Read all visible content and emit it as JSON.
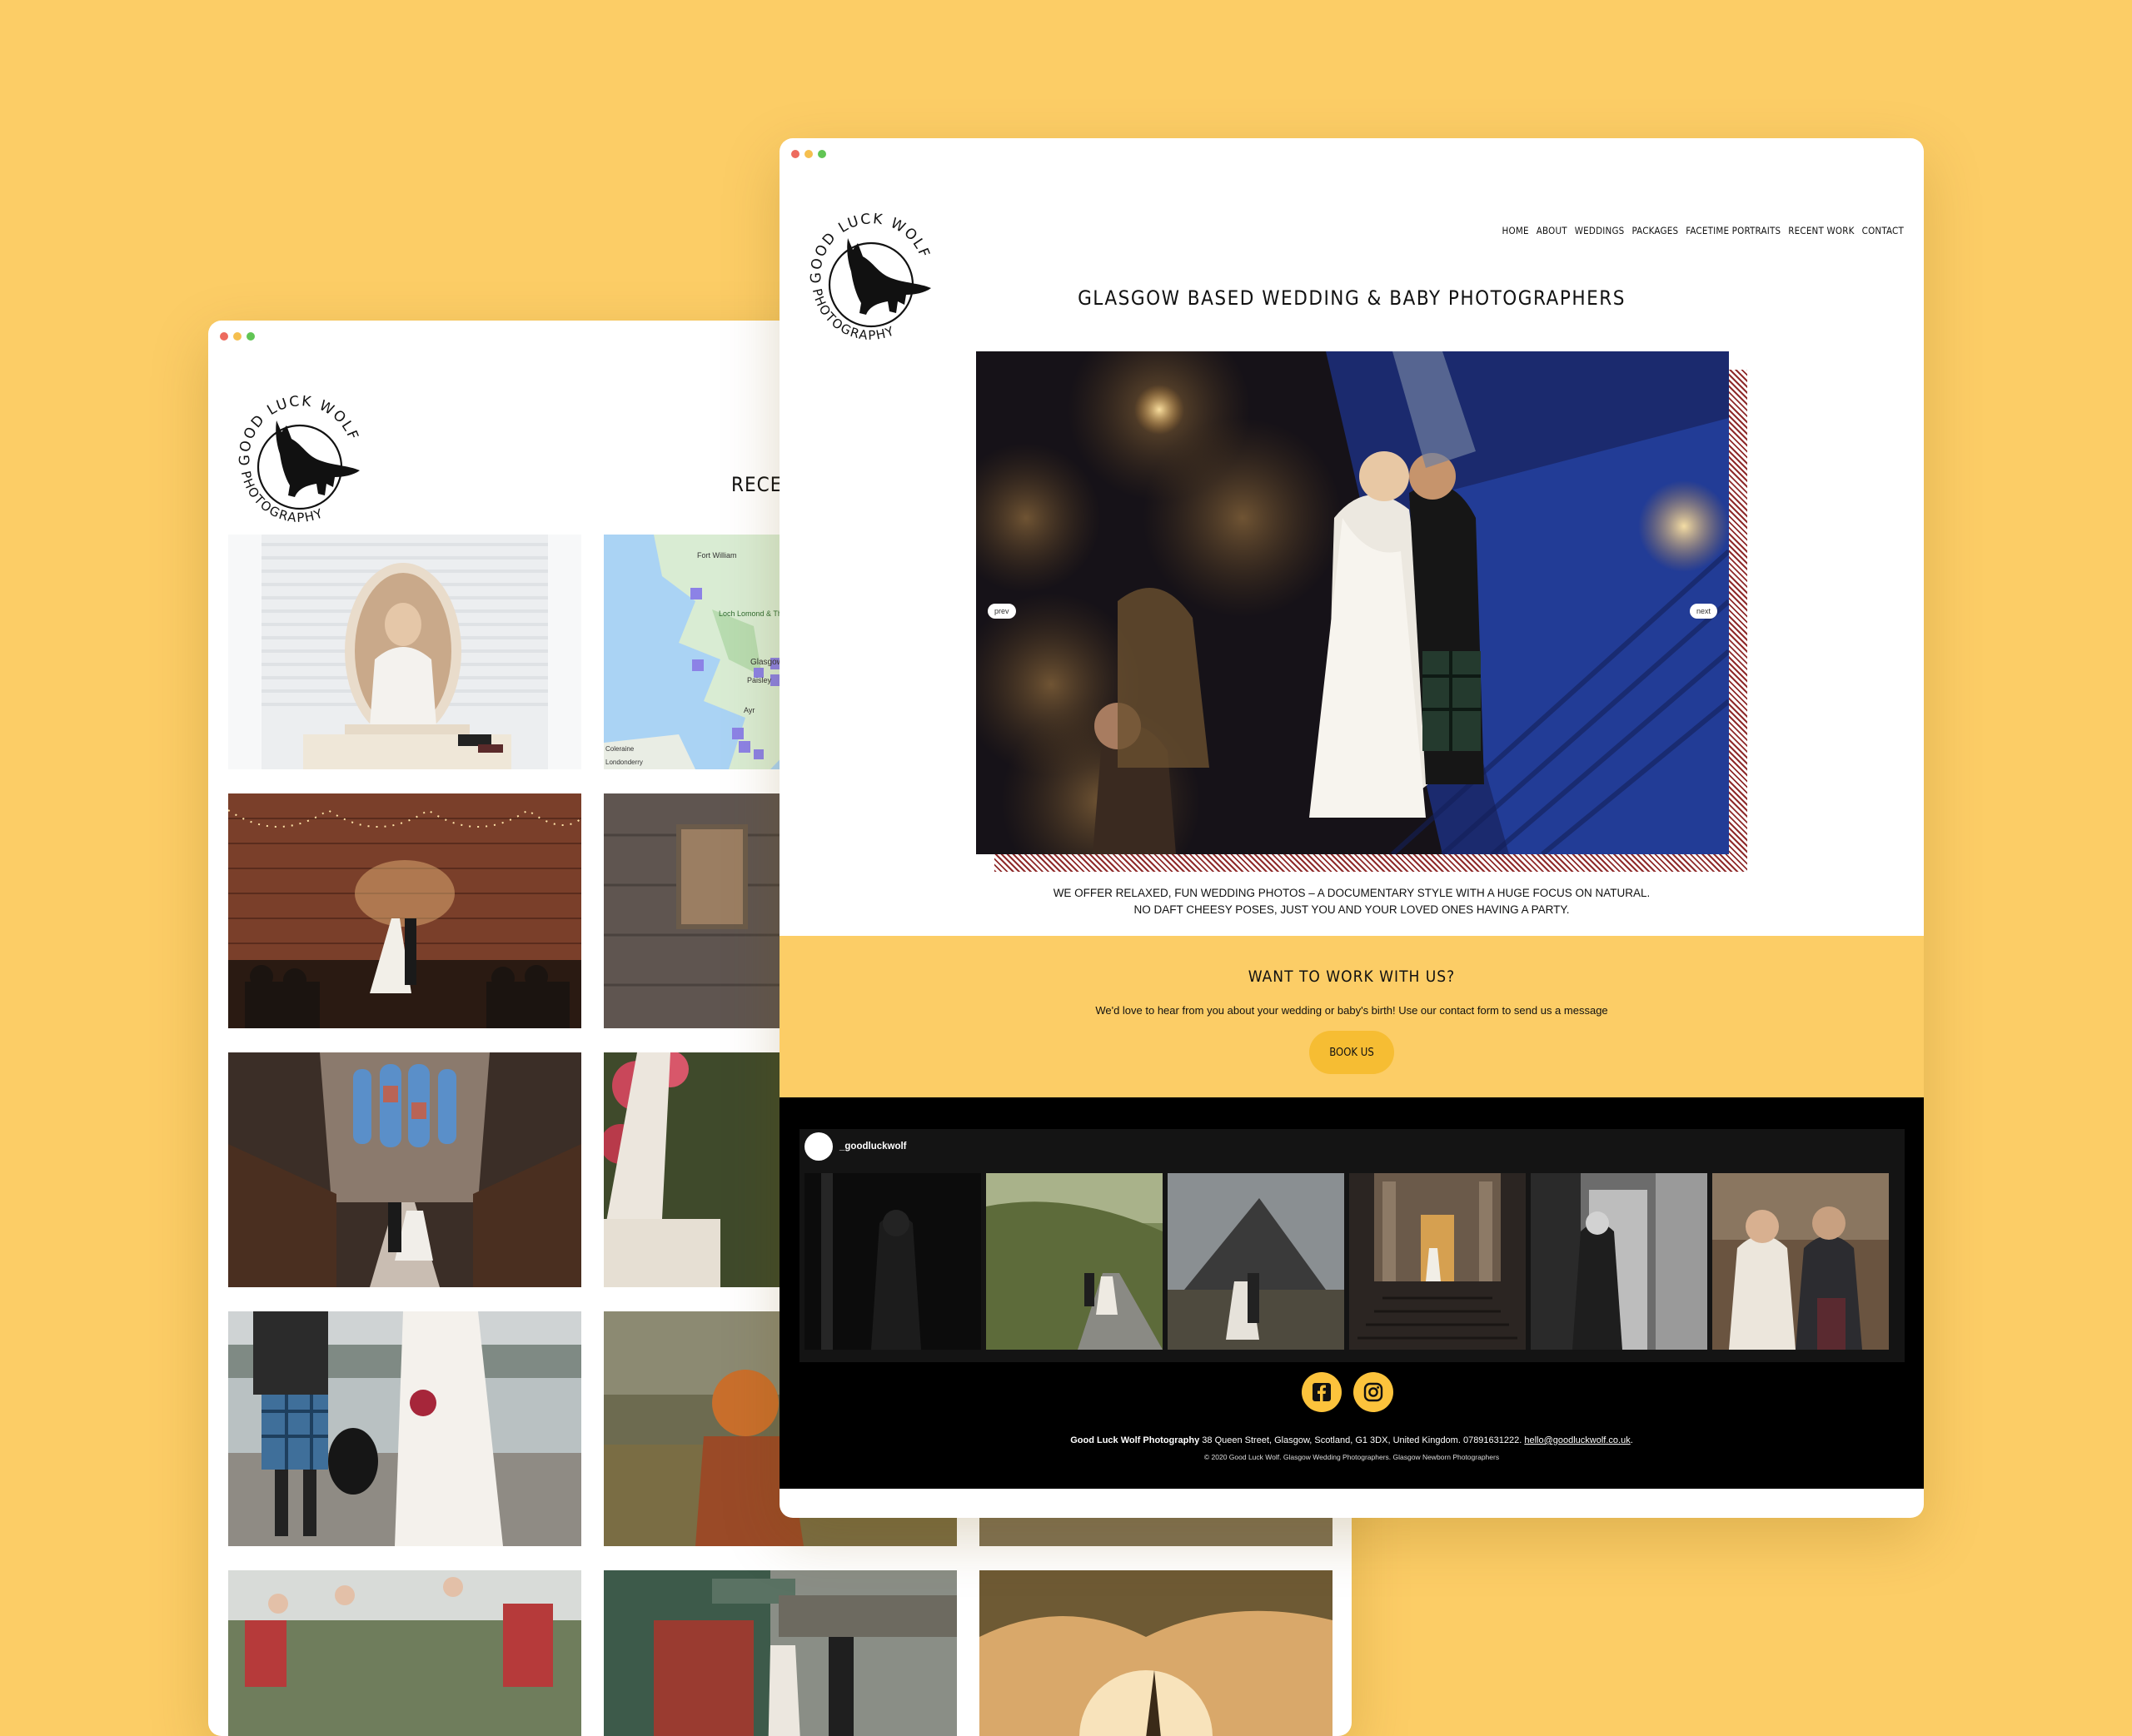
{
  "back_window": {
    "page_title": "RECENT WORK",
    "logo": {
      "top_text": "GOOD LUCK WOLF",
      "bottom_text": "PHOTOGRAPHY"
    },
    "map_labels": [
      "Fort William",
      "Loch Lomond & The Trossachs National Park",
      "Glasgow",
      "Paisley",
      "Ayr",
      "Coleraine",
      "Londonderry"
    ]
  },
  "front_window": {
    "logo": {
      "top_text": "GOOD LUCK WOLF",
      "bottom_text": "PHOTOGRAPHY"
    },
    "nav": [
      "HOME",
      "ABOUT",
      "WEDDINGS",
      "PACKAGES",
      "FACETIME PORTRAITS",
      "RECENT WORK",
      "CONTACT"
    ],
    "tagline": "GLASGOW BASED WEDDING & BABY PHOTOGRAPHERS",
    "slider": {
      "prev": "prev",
      "next": "next"
    },
    "description": [
      "WE OFFER RELAXED, FUN WEDDING PHOTOS – A DOCUMENTARY STYLE WITH A HUGE FOCUS ON NATURAL.",
      "NO DAFT CHEESY POSES, JUST YOU AND YOUR LOVED ONES HAVING A PARTY."
    ],
    "cta": {
      "heading": "WANT TO WORK WITH US?",
      "text": "We'd love to hear from you about your wedding or baby's birth! Use our contact form to send us a message",
      "button": "BOOK US"
    },
    "instagram": {
      "handle": "_goodluckwolf"
    },
    "social": [
      "facebook-icon",
      "instagram-icon"
    ],
    "footer": {
      "company": "Good Luck Wolf Photography",
      "address": " 38 Queen Street, Glasgow, Scotland, G1 3DX, United Kingdom. 07891631222. ",
      "email": "hello@goodluckwolf.co.uk",
      "email_suffix": ".",
      "copyright": "© 2020 Good Luck Wolf. Glasgow Wedding Photographers. Glasgow Newborn Photographers"
    }
  },
  "colors": {
    "background": "#fccd66",
    "accent": "#f6bd33",
    "hatch": "#8f2b2b",
    "footer": "#000000"
  }
}
